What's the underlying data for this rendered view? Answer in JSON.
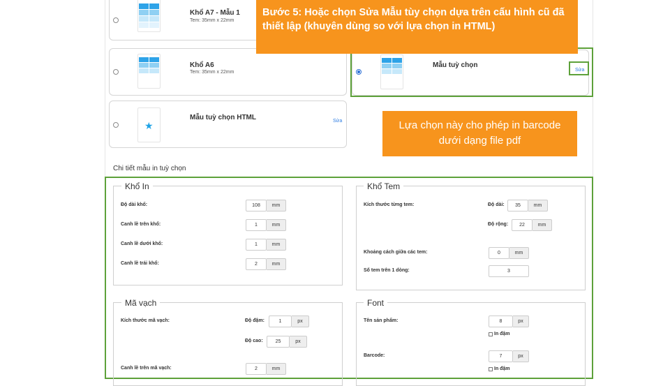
{
  "templates": {
    "a7": {
      "title": "Khổ A7 - Mẫu 1",
      "size": "Tem: 35mm x 22mm"
    },
    "a6": {
      "title": "Khổ A6",
      "size": "Tem: 35mm x 22mm"
    },
    "custom": {
      "title": "Mẫu tuỳ chọn",
      "edit": "Sửa"
    },
    "html": {
      "title": "Mẫu tuỳ chọn HTML",
      "edit": "Sửa"
    }
  },
  "callouts": {
    "step5": "Bước 5: Hoặc chọn Sửa Mẫu tùy chọn dựa trên cấu hình cũ đã thiết lập (khuyên dùng so với lựa chọn in HTML)",
    "pdf": "Lựa chọn này cho phép in barcode dưới dạng file pdf"
  },
  "section_title": "Chi tiết mẫu in tuỳ chọn",
  "kho_in": {
    "legend": "Khổ In",
    "rows": [
      {
        "label": "Độ dài khổ:",
        "value": "108",
        "unit": "mm"
      },
      {
        "label": "Canh lề trên khổ:",
        "value": "1",
        "unit": "mm"
      },
      {
        "label": "Canh lề dưới khổ:",
        "value": "1",
        "unit": "mm"
      },
      {
        "label": "Canh lề trái khổ:",
        "value": "2",
        "unit": "mm"
      }
    ]
  },
  "kho_tem": {
    "legend": "Khổ Tem",
    "size_label": "Kích thước từng tem:",
    "length_label": "Độ dài:",
    "length_value": "35",
    "length_unit": "mm",
    "width_label": "Độ rộng:",
    "width_value": "22",
    "width_unit": "mm",
    "gap_label": "Khoảng cách giữa các tem:",
    "gap_value": "0",
    "gap_unit": "mm",
    "count_label": "Số tem trên 1 dòng:",
    "count_value": "3"
  },
  "ma_vach": {
    "legend": "Mã vạch",
    "size_label": "Kích thước mã vạch:",
    "thick_label": "Độ đậm:",
    "thick_value": "1",
    "thick_unit": "px",
    "height_label": "Độ cao:",
    "height_value": "25",
    "height_unit": "px",
    "top_label": "Canh lề trên mã vạch:",
    "top_value": "2",
    "top_unit": "mm"
  },
  "font": {
    "legend": "Font",
    "product_label": "Tên sản phẩm:",
    "product_value": "8",
    "product_unit": "px",
    "product_bold": "In đậm",
    "barcode_label": "Barcode:",
    "barcode_value": "7",
    "barcode_unit": "px",
    "barcode_bold": "In đậm"
  },
  "colors": {
    "accent": "#f7941d",
    "highlight": "#5da13a",
    "link": "#2a7ae2",
    "radio": "#2a6fd6"
  }
}
